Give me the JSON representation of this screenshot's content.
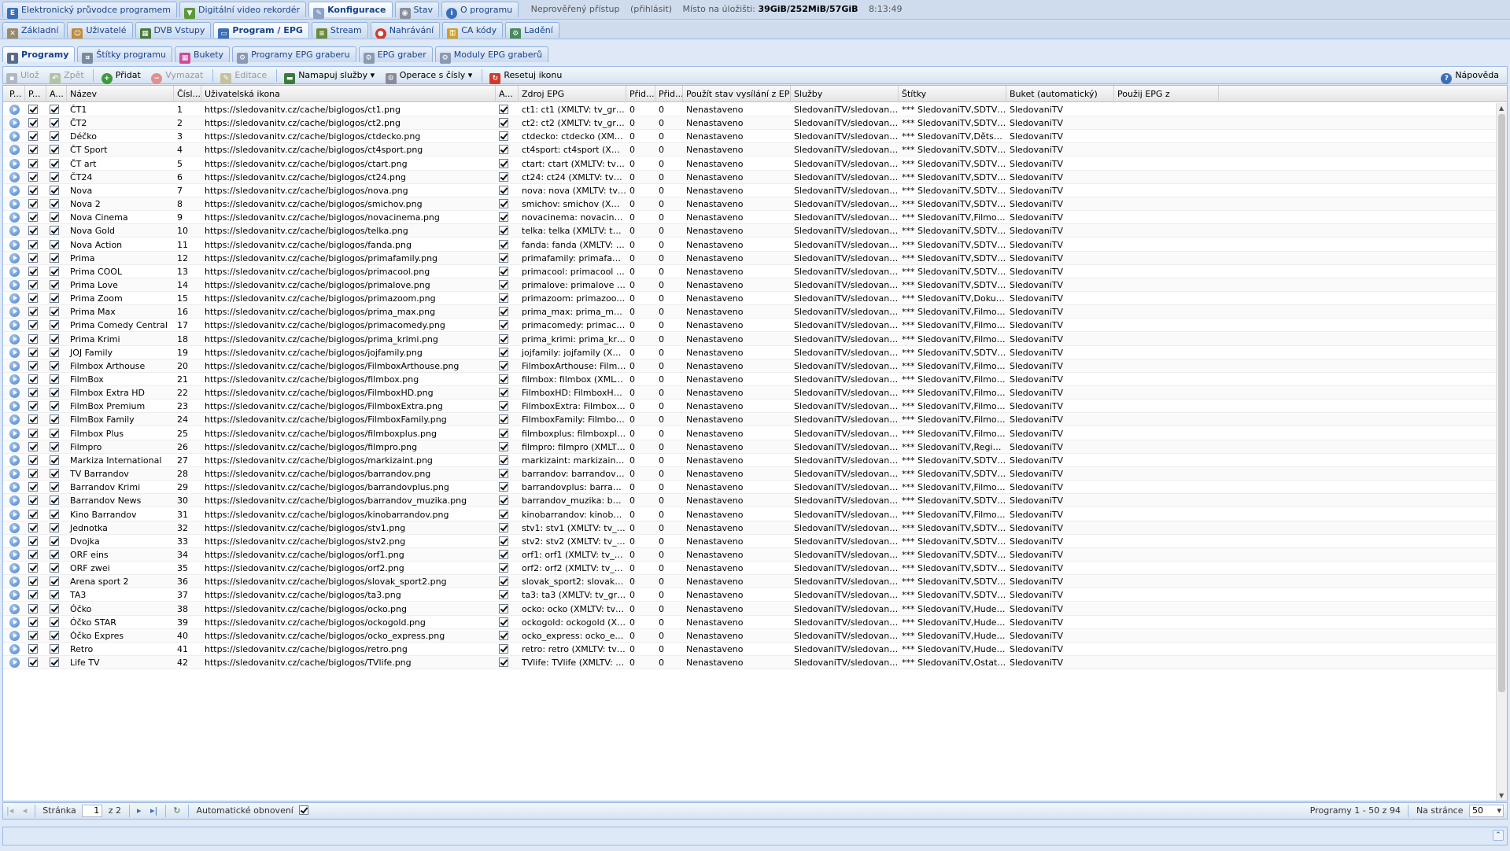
{
  "top_tabs": [
    "Elektronický průvodce programem",
    "Digitální video rekordér",
    "Konfigurace",
    "Stav",
    "O programu"
  ],
  "top_info": {
    "access": "Neprověřený přístup",
    "login": "(přihlásit)",
    "storage_label": "Místo na úložišti:",
    "storage_value": "39GiB/252MiB/57GiB",
    "time": "8:13:49"
  },
  "config_tabs": [
    "Základní",
    "Uživatelé",
    "DVB Vstupy",
    "Program / EPG",
    "Stream",
    "Nahrávání",
    "CA kódy",
    "Ladění"
  ],
  "sub_tabs": [
    "Programy",
    "Štítky programu",
    "Bukety",
    "Programy EPG graberu",
    "EPG graber",
    "Moduly EPG graberů"
  ],
  "toolbar": {
    "save": "Ulož",
    "back": "Zpět",
    "add": "Přidat",
    "delete": "Vymazat",
    "edit": "Editace",
    "map": "Namapuj služby",
    "numops": "Operace s čísly",
    "reseticon": "Resetuj ikonu",
    "help": "Nápověda"
  },
  "columns": [
    "P...",
    "P...",
    "A...",
    "Název",
    "Čísl...",
    "Uživatelská ikona",
    "A...",
    "Zdroj EPG",
    "Přid...",
    "Přid...",
    "Použít stav vysílání z EPG",
    "Služby",
    "Štítky",
    "Buket (automatický)",
    "Použij EPG z"
  ],
  "rows": [
    [
      "ČT1",
      "1",
      "ct1.png",
      "ct1: ct1 (XMLTV: tv_grab_file i...",
      "Nenastaveno",
      "SledovaniTV/sledovanitv-auto...",
      "*** SledovaniTV,SDTV,Sledov...",
      "SledovaniTV"
    ],
    [
      "ČT2",
      "2",
      "ct2.png",
      "ct2: ct2 (XMLTV: tv_grab_file i...",
      "Nenastaveno",
      "SledovaniTV/sledovanitv-auto...",
      "*** SledovaniTV,SDTV,Sledov...",
      "SledovaniTV"
    ],
    [
      "Déčko",
      "3",
      "ctdecko.png",
      "ctdecko: ctdecko (XMLTV: tv_...",
      "Nenastaveno",
      "SledovaniTV/sledovanitv-auto...",
      "*** SledovaniTV,Dětské,SDTV...",
      "SledovaniTV"
    ],
    [
      "ČT Sport",
      "4",
      "ct4sport.png",
      "ct4sport: ct4sport (XMLTV: tv...",
      "Nenastaveno",
      "SledovaniTV/sledovanitv-auto...",
      "*** SledovaniTV,SDTV,Sledov...",
      "SledovaniTV"
    ],
    [
      "ČT art",
      "5",
      "ctart.png",
      "ctart: ctart (XMLTV: tv_grab_fi...",
      "Nenastaveno",
      "SledovaniTV/sledovanitv-auto...",
      "*** SledovaniTV,SDTV,Sledov...",
      "SledovaniTV"
    ],
    [
      "ČT24",
      "6",
      "ct24.png",
      "ct24: ct24 (XMLTV: tv_grab_fil...",
      "Nenastaveno",
      "SledovaniTV/sledovanitv-auto...",
      "*** SledovaniTV,SDTV,Sledov...",
      "SledovaniTV"
    ],
    [
      "Nova",
      "7",
      "nova.png",
      "nova: nova (XMLTV: tv_grab_...",
      "Nenastaveno",
      "SledovaniTV/sledovanitv-auto...",
      "*** SledovaniTV,SDTV,Sledov...",
      "SledovaniTV"
    ],
    [
      "Nova 2",
      "8",
      "smichov.png",
      "smichov: smichov (XMLTV: tv...",
      "Nenastaveno",
      "SledovaniTV/sledovanitv-auto...",
      "*** SledovaniTV,SDTV,Sledov...",
      "SledovaniTV"
    ],
    [
      "Nova Cinema",
      "9",
      "novacinema.png",
      "novacinema: novacinema (X...",
      "Nenastaveno",
      "SledovaniTV/sledovanitv-auto...",
      "*** SledovaniTV,Filmové,SDT...",
      "SledovaniTV"
    ],
    [
      "Nova Gold",
      "10",
      "telka.png",
      "telka: telka (XMLTV: tv_grab_f...",
      "Nenastaveno",
      "SledovaniTV/sledovanitv-auto...",
      "*** SledovaniTV,SDTV,Sledov...",
      "SledovaniTV"
    ],
    [
      "Nova Action",
      "11",
      "fanda.png",
      "fanda: fanda (XMLTV: tv_grab...",
      "Nenastaveno",
      "SledovaniTV/sledovanitv-auto...",
      "*** SledovaniTV,SDTV,Sledov...",
      "SledovaniTV"
    ],
    [
      "Prima",
      "12",
      "primafamily.png",
      "primafamily: primafamily (XM...",
      "Nenastaveno",
      "SledovaniTV/sledovanitv-auto...",
      "*** SledovaniTV,SDTV,Sledov...",
      "SledovaniTV"
    ],
    [
      "Prima COOL",
      "13",
      "primacool.png",
      "primacool: primacool (XMLTV:...",
      "Nenastaveno",
      "SledovaniTV/sledovanitv-auto...",
      "*** SledovaniTV,SDTV,Sledov...",
      "SledovaniTV"
    ],
    [
      "Prima Love",
      "14",
      "primalove.png",
      "primalove: primalove (XMLTV:...",
      "Nenastaveno",
      "SledovaniTV/sledovanitv-auto...",
      "*** SledovaniTV,SDTV,Sledov...",
      "SledovaniTV"
    ],
    [
      "Prima Zoom",
      "15",
      "primazoom.png",
      "primazoom: primazoom (XML...",
      "Nenastaveno",
      "SledovaniTV/sledovanitv-auto...",
      "*** SledovaniTV,Dokumentárn...",
      "SledovaniTV"
    ],
    [
      "Prima Max",
      "16",
      "prima_max.png",
      "prima_max: prima_max (XML...",
      "Nenastaveno",
      "SledovaniTV/sledovanitv-auto...",
      "*** SledovaniTV,Filmové,SDT...",
      "SledovaniTV"
    ],
    [
      "Prima Comedy Central",
      "17",
      "primacomedy.png",
      "primacomedy: primacomedy (...",
      "Nenastaveno",
      "SledovaniTV/sledovanitv-auto...",
      "*** SledovaniTV,Filmové,SDT...",
      "SledovaniTV"
    ],
    [
      "Prima Krimi",
      "18",
      "prima_krimi.png",
      "prima_krimi: prima_krimi (XM...",
      "Nenastaveno",
      "SledovaniTV/sledovanitv-auto...",
      "*** SledovaniTV,Filmové,SDT...",
      "SledovaniTV"
    ],
    [
      "JOJ Family",
      "19",
      "jojfamily.png",
      "jojfamily: jojfamily (XMLTV: tv...",
      "Nenastaveno",
      "SledovaniTV/sledovanitv-auto...",
      "*** SledovaniTV,SDTV,Sledov...",
      "SledovaniTV"
    ],
    [
      "Filmbox Arthouse",
      "20",
      "FilmboxArthouse.png",
      "FilmboxArthouse: FilmboxArt...",
      "Nenastaveno",
      "SledovaniTV/sledovanitv-auto...",
      "*** SledovaniTV,Filmové,SDT...",
      "SledovaniTV"
    ],
    [
      "FilmBox",
      "21",
      "filmbox.png",
      "filmbox: filmbox (XMLTV: tv_g...",
      "Nenastaveno",
      "SledovaniTV/sledovanitv-auto...",
      "*** SledovaniTV,Filmové,SDT...",
      "SledovaniTV"
    ],
    [
      "Filmbox Extra HD",
      "22",
      "FilmboxHD.png",
      "FilmboxHD: FilmboxHD (XML...",
      "Nenastaveno",
      "SledovaniTV/sledovanitv-auto...",
      "*** SledovaniTV,Filmové,SDT...",
      "SledovaniTV"
    ],
    [
      "FilmBox Premium",
      "23",
      "FilmboxExtra.png",
      "FilmboxExtra: FilmboxExtra (...",
      "Nenastaveno",
      "SledovaniTV/sledovanitv-auto...",
      "*** SledovaniTV,Filmové,SDT...",
      "SledovaniTV"
    ],
    [
      "FilmBox Family",
      "24",
      "FilmboxFamily.png",
      "FilmboxFamily: FilmboxFamil...",
      "Nenastaveno",
      "SledovaniTV/sledovanitv-auto...",
      "*** SledovaniTV,Filmové,SDT...",
      "SledovaniTV"
    ],
    [
      "Filmbox Plus",
      "25",
      "filmboxplus.png",
      "filmboxplus: filmboxplus (XML...",
      "Nenastaveno",
      "SledovaniTV/sledovanitv-auto...",
      "*** SledovaniTV,Filmové,SDT...",
      "SledovaniTV"
    ],
    [
      "Filmpro",
      "26",
      "filmpro.png",
      "filmpro: filmpro (XMLTV: tv_gr...",
      "Nenastaveno",
      "SledovaniTV/sledovanitv-auto...",
      "*** SledovaniTV,Regionální,S...",
      "SledovaniTV"
    ],
    [
      "Markiza International",
      "27",
      "markizaint.png",
      "markizaint: markizaint (XMLTV...",
      "Nenastaveno",
      "SledovaniTV/sledovanitv-auto...",
      "*** SledovaniTV,SDTV,Sledov...",
      "SledovaniTV"
    ],
    [
      "TV Barrandov",
      "28",
      "barrandov.png",
      "barrandov: barrandov (XMLT...",
      "Nenastaveno",
      "SledovaniTV/sledovanitv-auto...",
      "*** SledovaniTV,SDTV,Sledov...",
      "SledovaniTV"
    ],
    [
      "Barrandov Krimi",
      "29",
      "barrandovplus.png",
      "barrandovplus: barrandovplus...",
      "Nenastaveno",
      "SledovaniTV/sledovanitv-auto...",
      "*** SledovaniTV,Filmové,SDT...",
      "SledovaniTV"
    ],
    [
      "Barrandov News",
      "30",
      "barrandov_muzika.png",
      "barrandov_muzika: barrandov...",
      "Nenastaveno",
      "SledovaniTV/sledovanitv-auto...",
      "*** SledovaniTV,SDTV,Sledov...",
      "SledovaniTV"
    ],
    [
      "Kino Barrandov",
      "31",
      "kinobarrandov.png",
      "kinobarrandov: kinobarrandov...",
      "Nenastaveno",
      "SledovaniTV/sledovanitv-auto...",
      "*** SledovaniTV,Filmové,SDT...",
      "SledovaniTV"
    ],
    [
      "Jednotka",
      "32",
      "stv1.png",
      "stv1: stv1 (XMLTV: tv_grab_fil...",
      "Nenastaveno",
      "SledovaniTV/sledovanitv-auto...",
      "*** SledovaniTV,SDTV,Sledov...",
      "SledovaniTV"
    ],
    [
      "Dvojka",
      "33",
      "stv2.png",
      "stv2: stv2 (XMLTV: tv_grab_fil...",
      "Nenastaveno",
      "SledovaniTV/sledovanitv-auto...",
      "*** SledovaniTV,SDTV,Sledov...",
      "SledovaniTV"
    ],
    [
      "ORF eins",
      "34",
      "orf1.png",
      "orf1: orf1 (XMLTV: tv_grab_fil...",
      "Nenastaveno",
      "SledovaniTV/sledovanitv-auto...",
      "*** SledovaniTV,SDTV,Sledov...",
      "SledovaniTV"
    ],
    [
      "ORF zwei",
      "35",
      "orf2.png",
      "orf2: orf2 (XMLTV: tv_grab_fil...",
      "Nenastaveno",
      "SledovaniTV/sledovanitv-auto...",
      "*** SledovaniTV,SDTV,Sledov...",
      "SledovaniTV"
    ],
    [
      "Arena sport 2",
      "36",
      "slovak_sport2.png",
      "slovak_sport2: slovak_sport2 ...",
      "Nenastaveno",
      "SledovaniTV/sledovanitv-auto...",
      "*** SledovaniTV,SDTV,Sledov...",
      "SledovaniTV"
    ],
    [
      "TA3",
      "37",
      "ta3.png",
      "ta3: ta3 (XMLTV: tv_grab_file ...",
      "Nenastaveno",
      "SledovaniTV/sledovanitv-auto...",
      "*** SledovaniTV,SDTV,Sledov...",
      "SledovaniTV"
    ],
    [
      "Óčko",
      "38",
      "ocko.png",
      "ocko: ocko (XMLTV: tv_grab_f...",
      "Nenastaveno",
      "SledovaniTV/sledovanitv-auto...",
      "*** SledovaniTV,Hudební & Lif...",
      "SledovaniTV"
    ],
    [
      "Óčko STAR",
      "39",
      "ockogold.png",
      "ockogold: ockogold (XMLTV: t...",
      "Nenastaveno",
      "SledovaniTV/sledovanitv-auto...",
      "*** SledovaniTV,Hudební & Lif...",
      "SledovaniTV"
    ],
    [
      "Óčko Expres",
      "40",
      "ocko_express.png",
      "ocko_express: ocko_express ...",
      "Nenastaveno",
      "SledovaniTV/sledovanitv-auto...",
      "*** SledovaniTV,Hudební & Lif...",
      "SledovaniTV"
    ],
    [
      "Retro",
      "41",
      "retro.png",
      "retro: retro (XMLTV: tv_grab_f...",
      "Nenastaveno",
      "SledovaniTV/sledovanitv-auto...",
      "*** SledovaniTV,Hudební & Lif...",
      "SledovaniTV"
    ],
    [
      "Life TV",
      "42",
      "TVlife.png",
      "TVlife: TVlife (XMLTV: tv_gra...",
      "Nenastaveno",
      "SledovaniTV/sledovanitv-auto...",
      "*** SledovaniTV,Ostatní,SDT...",
      "SledovaniTV"
    ]
  ],
  "url_prefix": "https://sledovanitv.cz/cache/biglogos/",
  "added_value": "0",
  "pager": {
    "page_label": "Stránka",
    "page": "1",
    "of": "z 2",
    "auto_refresh": "Automatické obnovení",
    "summary": "Programy 1 - 50 z 94",
    "per_page_label": "Na stránce",
    "per_page": "50"
  },
  "colors": {
    "accent": "#15428b",
    "border": "#99bbe8",
    "bg": "#dfe8f6"
  }
}
